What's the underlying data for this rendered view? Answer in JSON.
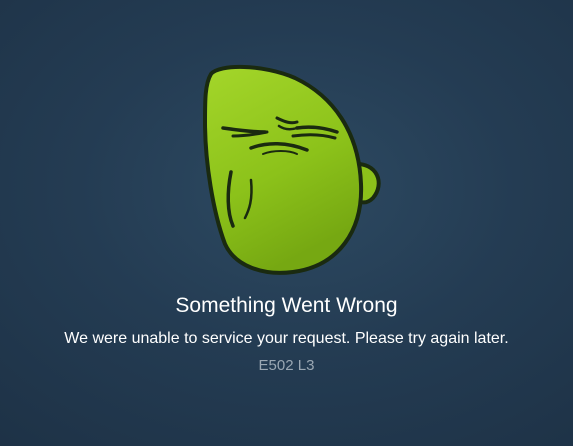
{
  "error": {
    "mascot_icon": "frustrated-green-blob-icon",
    "title": "Something Went Wrong",
    "message": "We were unable to service your request. Please try again later.",
    "code": "E502 L3"
  },
  "colors": {
    "background": "#243c53",
    "mascot_fill": "#8cc21a",
    "mascot_outline": "#1a2a10",
    "title_text": "#ffffff",
    "code_text": "#9aa7b3"
  }
}
